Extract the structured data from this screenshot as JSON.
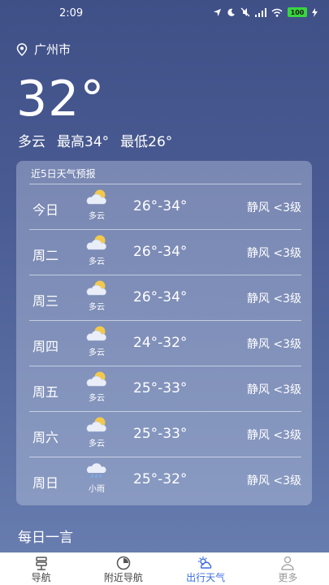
{
  "status_bar": {
    "time": "2:09",
    "battery": "100"
  },
  "location": {
    "city": "广州市"
  },
  "current": {
    "temperature": "32°",
    "condition": "多云",
    "high": "最高34°",
    "low": "最低26°"
  },
  "forecast": {
    "title": "近5日天气预报",
    "days": [
      {
        "day": "今日",
        "icon": "partly-cloudy-icon",
        "condition": "多云",
        "range": "26°-34°",
        "wind": "静风 <3级"
      },
      {
        "day": "周二",
        "icon": "partly-cloudy-icon",
        "condition": "多云",
        "range": "26°-34°",
        "wind": "静风 <3级"
      },
      {
        "day": "周三",
        "icon": "partly-cloudy-icon",
        "condition": "多云",
        "range": "26°-34°",
        "wind": "静风 <3级"
      },
      {
        "day": "周四",
        "icon": "partly-cloudy-icon",
        "condition": "多云",
        "range": "24°-32°",
        "wind": "静风 <3级"
      },
      {
        "day": "周五",
        "icon": "partly-cloudy-icon",
        "condition": "多云",
        "range": "25°-33°",
        "wind": "静风 <3级"
      },
      {
        "day": "周六",
        "icon": "partly-cloudy-icon",
        "condition": "多云",
        "range": "25°-33°",
        "wind": "静风 <3级"
      },
      {
        "day": "周日",
        "icon": "light-rain-icon",
        "condition": "小雨",
        "range": "25°-32°",
        "wind": "静风 <3级"
      }
    ]
  },
  "daily_quote": {
    "heading": "每日一言"
  },
  "tab_bar": {
    "active_color": "#3a6be0",
    "tabs": [
      {
        "label": "导航",
        "icon": "navigation-icon"
      },
      {
        "label": "附近导航",
        "icon": "nearby-icon"
      },
      {
        "label": "出行天气",
        "icon": "weather-icon"
      },
      {
        "label": "更多",
        "icon": "profile-icon"
      }
    ]
  }
}
